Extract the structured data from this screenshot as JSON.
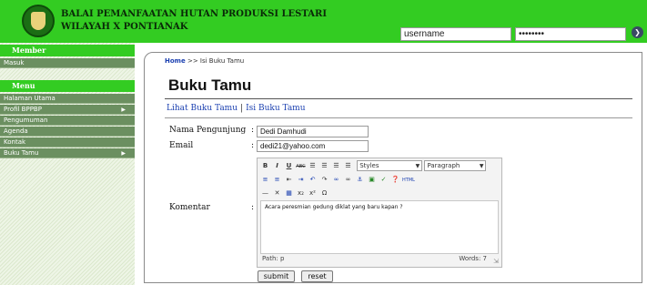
{
  "header": {
    "title_line1": "BALAI PEMANFAATAN HUTAN PRODUKSI LESTARI",
    "title_line2": "WILAYAH X PONTIANAK",
    "username_value": "username",
    "password_value": "••••••••",
    "go_glyph": "❯"
  },
  "sidebar": {
    "member_heading": "Member",
    "member_items": [
      {
        "label": "Masuk"
      }
    ],
    "menu_heading": "Menu",
    "menu_items": [
      {
        "label": "Halaman Utama",
        "arrow": ""
      },
      {
        "label": "Profil BPPBP",
        "arrow": "▶"
      },
      {
        "label": "Pengumuman",
        "arrow": ""
      },
      {
        "label": "Agenda",
        "arrow": ""
      },
      {
        "label": "Kontak",
        "arrow": ""
      },
      {
        "label": "Buku Tamu",
        "arrow": "▶"
      }
    ]
  },
  "main": {
    "breadcrumb_home": "Home",
    "breadcrumb_sep": ">>",
    "breadcrumb_current": "Isi Buku Tamu",
    "title": "Buku Tamu",
    "link_lihat": "Lihat Buku Tamu",
    "link_sep": "|",
    "link_isi": "Isi Buku Tamu",
    "form": {
      "nama_label": "Nama Pengunjung",
      "nama_value": "Dedi Damhudi",
      "email_label": "Email",
      "email_value": "dedi21@yahoo.com",
      "komentar_label": "Komentar",
      "colon": ":"
    },
    "editor": {
      "styles_value": "Styles",
      "paragraph_value": "Paragraph",
      "content": "Acara peresmian gedung diklat yang baru  kapan ?",
      "path": "Path: p",
      "words": "Words: 7",
      "html_label": "HTML"
    },
    "submit_label": "submit",
    "reset_label": "reset"
  }
}
